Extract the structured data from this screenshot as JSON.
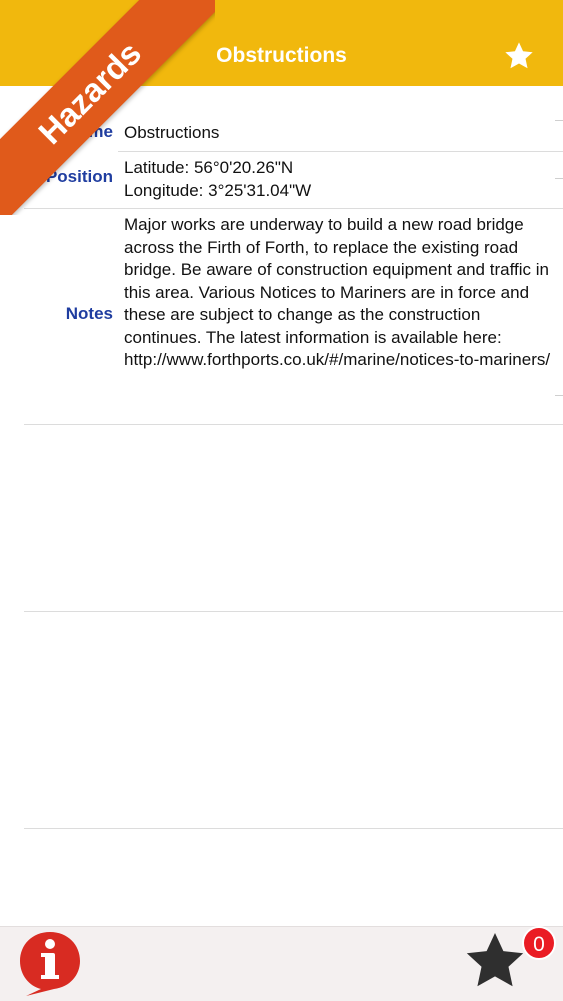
{
  "header": {
    "title": "Obstructions",
    "ribbon": "Hazards",
    "star_icon": "star-icon"
  },
  "details": {
    "name_label": "Name",
    "name_value": "Obstructions",
    "position_label": "Position",
    "latitude": "Latitude: 56°0'20.26\"N",
    "longitude": "Longitude: 3°25'31.04\"W",
    "notes_label": "Notes",
    "notes_value": "Major works are underway to build a new road bridge across the Firth of Forth, to replace the existing road bridge.  Be aware of construction equipment and traffic in this area.  Various Notices to Mariners are in force and these are subject to change as the construction continues.  The latest information is available here: http://www.forthports.co.uk/#/marine/notices-to-mariners/"
  },
  "toolbar": {
    "info_icon": "info-icon",
    "favorites_icon": "star-icon",
    "badge_count": "0"
  },
  "colors": {
    "header": "#f1b80d",
    "ribbon": "#e05a1b",
    "label": "#1f3da0",
    "badge": "#ea1c24"
  }
}
